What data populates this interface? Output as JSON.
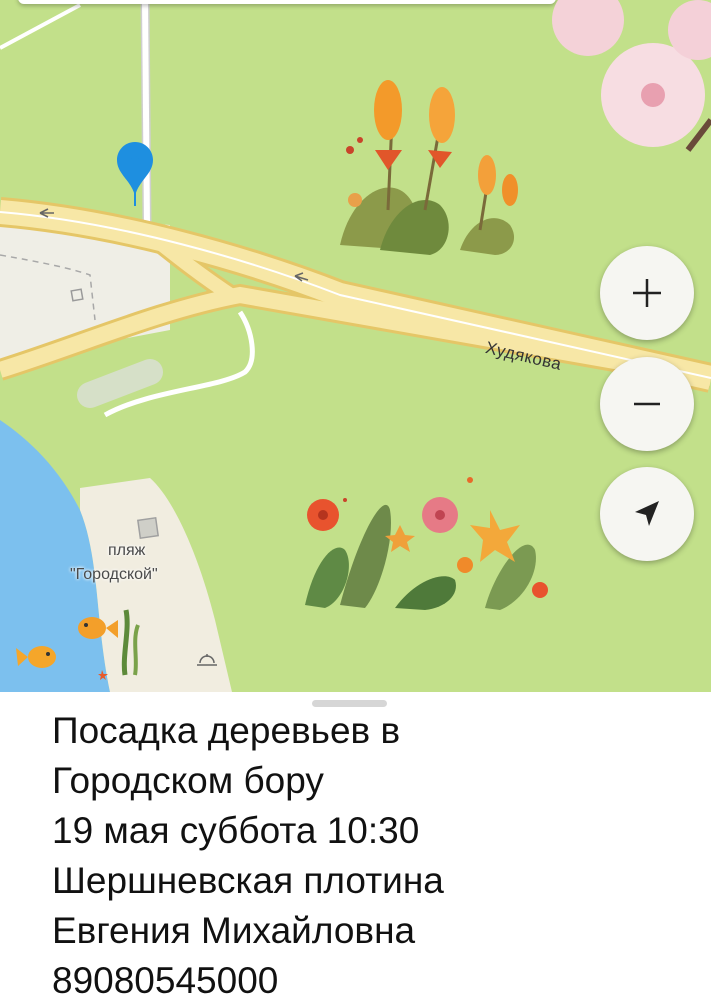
{
  "map": {
    "street_name": "Худякова",
    "poi_line1": "пляж",
    "poi_line2": "\"Городской\"",
    "colors": {
      "park": "#c2e08a",
      "water": "#7cc0ee",
      "road": "#f7e7a6",
      "road_edge": "#e5c667",
      "pin": "#1e8fe0"
    }
  },
  "controls": {
    "zoom_in_icon": "plus-icon",
    "zoom_out_icon": "minus-icon",
    "locate_icon": "navigation-arrow-icon"
  },
  "event": {
    "lines": [
      "Посадка деревьев в",
      "Городском бору",
      "19 мая суббота 10:30",
      "Шершневская плотина",
      "Евгения Михайловна",
      "89080545000"
    ]
  }
}
